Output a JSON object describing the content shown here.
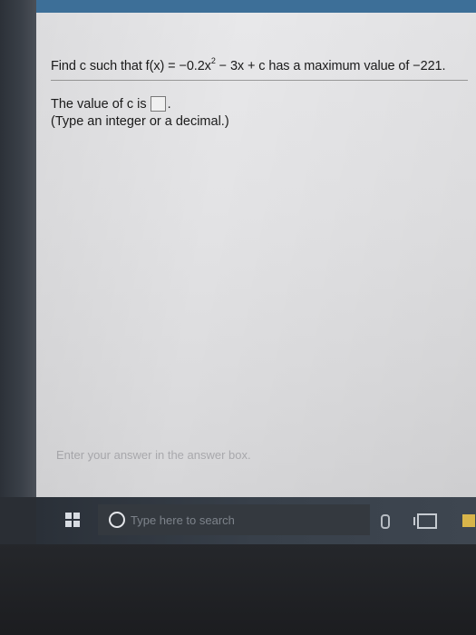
{
  "problem": {
    "prefix": "Find c such that f(x) = ",
    "coef": "−0.2x",
    "exponent": "2",
    "rest": " − 3x + c has a maximum value of ",
    "max_value": "−221",
    "end": "."
  },
  "answer": {
    "label": "The value of c is",
    "value": "",
    "end": ".",
    "hint": "(Type an integer or a decimal.)"
  },
  "status_message": "Enter your answer in the answer box.",
  "taskbar": {
    "search_placeholder": "Type here to search",
    "start_icon": "windows-logo-icon",
    "search_icon": "cortana-circle-icon",
    "mic_icon": "microphone-icon",
    "taskview_icon": "task-view-icon",
    "explorer_icon": "file-explorer-icon"
  },
  "colors": {
    "screen_bg": "#e3e3e5",
    "taskbar_bg": "#38404a",
    "title_bar": "#3d6f98"
  }
}
